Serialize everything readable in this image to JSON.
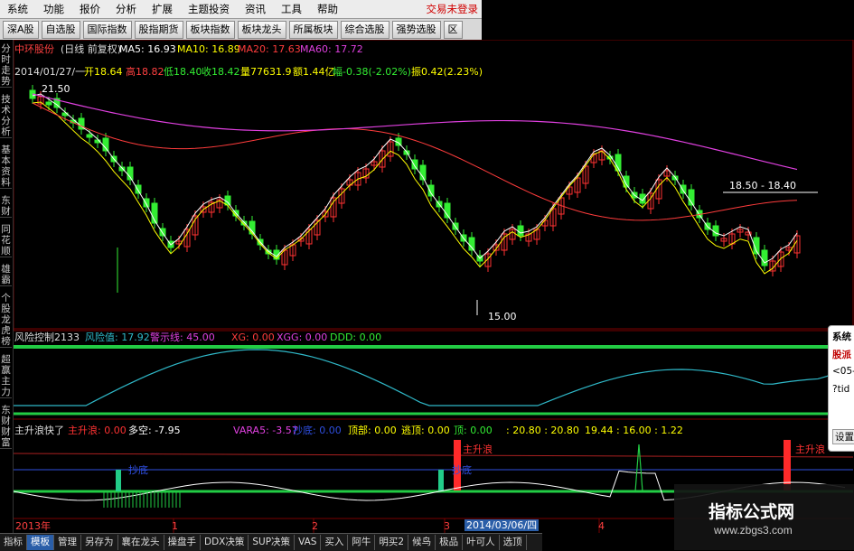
{
  "menubar": {
    "items": [
      "系统",
      "功能",
      "报价",
      "分析",
      "扩展",
      "主题投资",
      "资讯",
      "工具",
      "帮助"
    ],
    "status_text": "交易未登录"
  },
  "toolbar": {
    "buttons": [
      "深A股",
      "自选股",
      "国际指数",
      "股指期货",
      "板块指数",
      "板块龙头",
      "所属板块",
      "综合选股",
      "强势选股",
      "区"
    ]
  },
  "left_tabs": [
    "分时走势",
    "技术分析",
    "基本资料",
    "东财",
    "同花顺",
    "雄霸",
    "个股龙虎榜",
    "超赢主力",
    "东财财富"
  ],
  "chart_header": {
    "stock_name": "中环股份",
    "period": "(日线 前复权)",
    "ma5": "MA5: 16.93",
    "ma10": "MA10: 16.89",
    "ma20": "MA20: 17.63",
    "ma60": "MA60: 17.72"
  },
  "ohlc_line": {
    "date": "2014/01/27/一",
    "open": "开18.64",
    "high": "高18.82",
    "low": "低18.40",
    "close": "收18.42",
    "volume": "量77631.9",
    "amount": "额1.44亿",
    "change": "幅-0.38(-2.02%)",
    "amplitude": "振0.42(2.23%)"
  },
  "annotations": {
    "high_mark": "21.50",
    "low_mark": "15.00",
    "range_mark": "18.50 - 18.40"
  },
  "risk_panel": {
    "title": "风险控制2133",
    "risk_value": "风险值: 17.92",
    "warn_line": "警示线: 45.00",
    "xg": "XG: 0.00",
    "xgg": "XGG: 0.00",
    "ddd": "DDD: 0.00"
  },
  "main_panel": {
    "title": "主升浪快了",
    "zsl": "主升浪: 0.00",
    "dk": "多空: -7.95",
    "vara5": "VARA5: -3.57",
    "cd": "抄底: 0.00",
    "dbu": "顶部: 0.00",
    "xd": "逃顶: 0.00",
    "xiang": "顶: 0.00",
    "values": ": 20.80 : 20.80",
    "values2": "19.44 : 16.00 : 1.22",
    "sig_zsl1": "主升浪",
    "sig_zsl2": "主升浪",
    "sig_cd1": "抄底",
    "sig_cd2": "抄底"
  },
  "date_axis": {
    "year": "2013年",
    "m1": "1",
    "m2": "2",
    "m3": "3",
    "cursor_date": "2014/03/06/四",
    "m4": "4"
  },
  "bottom_tabs": [
    "指标",
    "模板",
    "管理",
    "另存为",
    "襄在龙头",
    "操盘手",
    "DDX决策",
    "SUP决策",
    "VAS",
    "买入",
    "阿牛",
    "明买2",
    "候鸟",
    "极品",
    "叶可人",
    "选顶"
  ],
  "popup": {
    "title": "系统",
    "l1": "股派",
    "l2": "<05-",
    "l3": "?tid",
    "btn": "设置"
  },
  "watermark": {
    "title": "指标公式网",
    "url": "www.zbgs3.com"
  },
  "colors": {
    "up": "#ff3232",
    "down": "#33ee33",
    "ma5": "#ffffff",
    "ma10": "#ffff00",
    "ma20": "#ff3c3c",
    "ma60": "#e040e0",
    "risk": "#2fb8c8",
    "band": "#22cc44",
    "link": "#4fc3ff",
    "grid": "#7a0000"
  }
}
